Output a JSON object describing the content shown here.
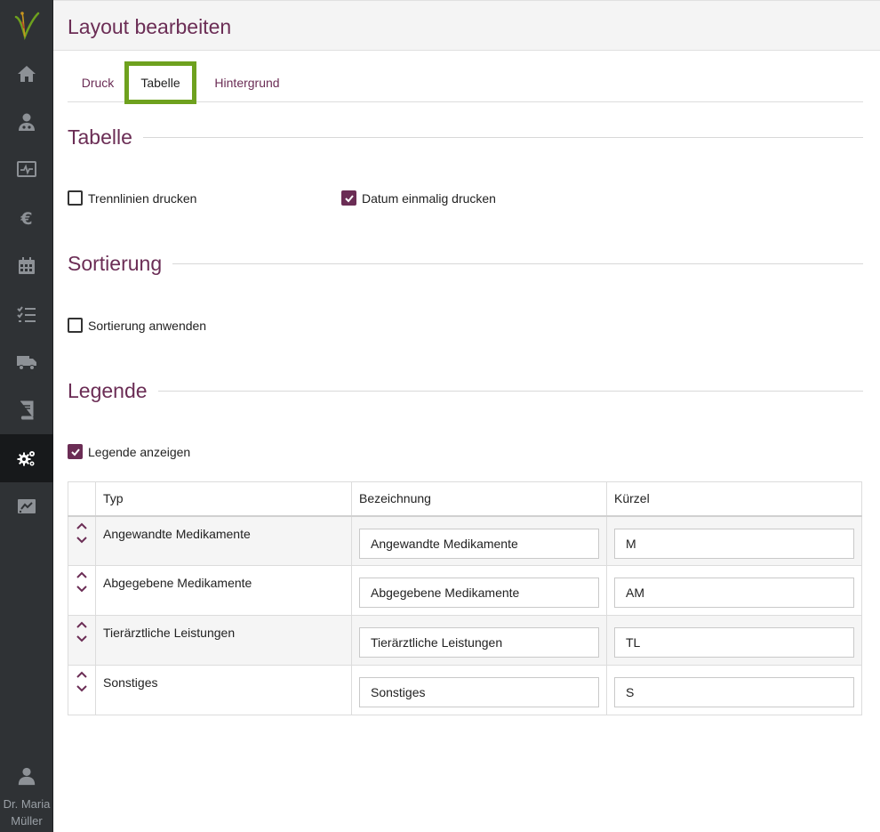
{
  "sidebar": {
    "items": [
      {
        "name": "home"
      },
      {
        "name": "patients"
      },
      {
        "name": "monitor"
      },
      {
        "name": "billing"
      },
      {
        "name": "calendar"
      },
      {
        "name": "tasks"
      },
      {
        "name": "delivery"
      },
      {
        "name": "book"
      },
      {
        "name": "settings",
        "active": true
      },
      {
        "name": "reports"
      }
    ],
    "user": {
      "name": "Dr. Maria Müller"
    }
  },
  "header": {
    "title": "Layout bearbeiten"
  },
  "tabs": [
    {
      "label": "Druck"
    },
    {
      "label": "Tabelle",
      "active": true
    },
    {
      "label": "Hintergrund"
    }
  ],
  "sections": {
    "tabelle": {
      "title": "Tabelle",
      "options": [
        {
          "label": "Trennlinien drucken",
          "checked": false
        },
        {
          "label": "Datum einmalig drucken",
          "checked": true
        }
      ]
    },
    "sortierung": {
      "title": "Sortierung",
      "options": [
        {
          "label": "Sortierung anwenden",
          "checked": false
        }
      ]
    },
    "legende": {
      "title": "Legende",
      "options": [
        {
          "label": "Legende anzeigen",
          "checked": true
        }
      ],
      "table": {
        "headers": [
          "Typ",
          "Bezeichnung",
          "Kürzel"
        ],
        "rows": [
          {
            "typ": "Angewandte Medikamente",
            "bezeichnung": "Angewandte Medikamente",
            "kuerzel": "M"
          },
          {
            "typ": "Abgegebene Medikamente",
            "bezeichnung": "Abgegebene Medikamente",
            "kuerzel": "AM"
          },
          {
            "typ": "Tierärztliche Leistungen",
            "bezeichnung": "Tierärztliche Leistungen",
            "kuerzel": "TL"
          },
          {
            "typ": "Sonstiges",
            "bezeichnung": "Sonstiges",
            "kuerzel": "S"
          }
        ]
      }
    }
  },
  "colors": {
    "accent": "#6b2d55",
    "tab_highlight": "#6ea11e",
    "sidebar_bg": "#2f3235"
  }
}
